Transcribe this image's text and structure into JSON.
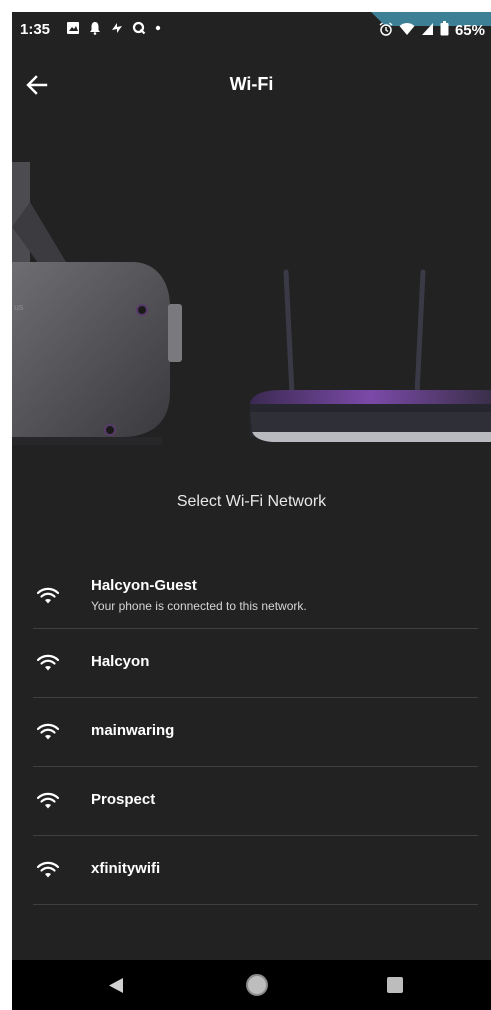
{
  "status_bar": {
    "time": "1:35",
    "battery": "65%",
    "icons_left": [
      "image-icon",
      "notification-icon",
      "sync-icon",
      "q-app-icon",
      "dot-icon"
    ],
    "icons_right": [
      "alarm-icon",
      "wifi-signal-icon",
      "cell-signal-icon",
      "battery-icon"
    ]
  },
  "header": {
    "title": "Wi-Fi",
    "back_icon": "back-arrow-icon"
  },
  "hero": {
    "illustration": "headset-and-router"
  },
  "subtitle": "Select Wi-Fi Network",
  "networks": [
    {
      "name": "Halcyon-Guest",
      "status": "Your phone is connected to this network.",
      "icon": "wifi-icon"
    },
    {
      "name": "Halcyon",
      "icon": "wifi-icon"
    },
    {
      "name": "mainwaring",
      "icon": "wifi-icon"
    },
    {
      "name": "Prospect",
      "icon": "wifi-icon"
    },
    {
      "name": "xfinitywifi",
      "icon": "wifi-icon"
    }
  ],
  "nav_bar": {
    "back": "nav-back-icon",
    "home": "nav-home-icon",
    "recents": "nav-recents-icon"
  },
  "colors": {
    "background": "#222222",
    "text": "#ffffff",
    "divider": "#3f3f3f",
    "accent": "#3d7f95"
  }
}
